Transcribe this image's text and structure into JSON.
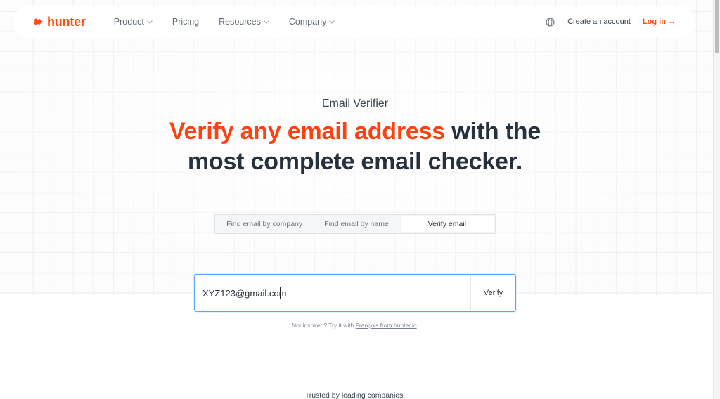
{
  "nav": {
    "logo_text": "hunter",
    "menu": [
      {
        "label": "Product",
        "has_dropdown": true
      },
      {
        "label": "Pricing",
        "has_dropdown": false
      },
      {
        "label": "Resources",
        "has_dropdown": true
      },
      {
        "label": "Company",
        "has_dropdown": true
      }
    ],
    "language_icon": "globe-icon",
    "create_account": "Create an account",
    "login": "Log in →"
  },
  "hero": {
    "eyebrow": "Email Verifier",
    "headline_accent": "Verify any email address",
    "headline_rest_1": " with the",
    "headline_line_2": "most complete email checker."
  },
  "tabs": [
    {
      "label": "Find email by company",
      "active": false
    },
    {
      "label": "Find email by name",
      "active": false
    },
    {
      "label": "Verify email",
      "active": true
    }
  ],
  "verifier": {
    "input_value": "XYZ123@gmail.com",
    "button_label": "Verify"
  },
  "hint": {
    "prefix": "Not inspired? Try it with ",
    "link": "François from hunter.io",
    "suffix": "."
  },
  "trusted_text": "Trusted by leading companies.",
  "colors": {
    "brand": "#ff4b10",
    "focus_border": "#5aa9f2",
    "heading": "#27313c"
  }
}
